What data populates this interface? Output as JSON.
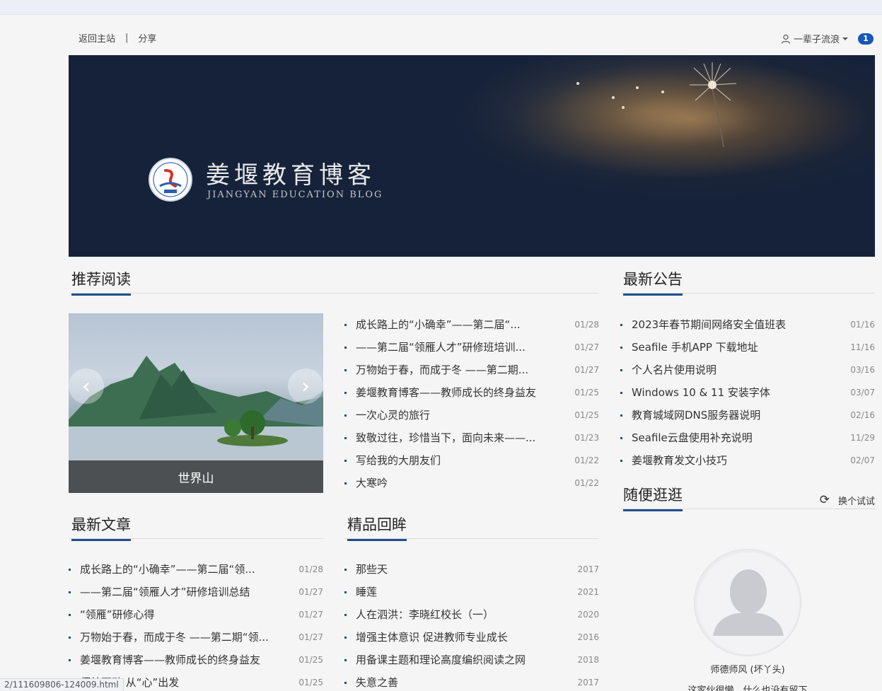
{
  "topbar": {
    "home_link": "返回主站",
    "divider": "|",
    "share_link": "分享",
    "username": "一辈子流浪",
    "notifications": "1"
  },
  "banner": {
    "title": "姜堰教育博客",
    "subtitle": "JIANGYAN EDUCATION BLOG"
  },
  "recommended": {
    "heading": "推荐阅读",
    "slide_caption": "世界山",
    "items": [
      {
        "title": "成长路上的“小确幸”——第二届“...",
        "date": "01/28"
      },
      {
        "title": "——第二届“领雁人才”研修班培训...",
        "date": "01/27"
      },
      {
        "title": "万物始于春，而成于冬 ——第二期...",
        "date": "01/27"
      },
      {
        "title": "姜堰教育博客——教师成长的终身益友",
        "date": "01/25"
      },
      {
        "title": "一次心灵的旅行",
        "date": "01/25"
      },
      {
        "title": "致敬过往，珍惜当下，面向未来——...",
        "date": "01/23"
      },
      {
        "title": "写给我的大朋友们",
        "date": "01/22"
      },
      {
        "title": "大寒吟",
        "date": "01/22"
      }
    ]
  },
  "announcements": {
    "heading": "最新公告",
    "items": [
      {
        "title": "2023年春节期间网络安全值班表",
        "date": "01/16"
      },
      {
        "title": "Seafile 手机APP 下载地址",
        "date": "11/16"
      },
      {
        "title": "个人名片使用说明",
        "date": "03/16"
      },
      {
        "title": "Windows 10 & 11 安装字体",
        "date": "03/07"
      },
      {
        "title": "教育城域网DNS服务器说明",
        "date": "02/16"
      },
      {
        "title": "Seafile云盘使用补充说明",
        "date": "11/29"
      },
      {
        "title": "姜堰教育发文小技巧",
        "date": "02/07"
      }
    ]
  },
  "random": {
    "heading": "随便逛逛",
    "refresh_label": "换个试试",
    "author": "师德师风 (坏丫头)",
    "author_desc": "这家伙很懒，什么也没有留下"
  },
  "latest": {
    "heading": "最新文章",
    "items": [
      {
        "title": "成长路上的“小确幸”——第二届“领...",
        "date": "01/28"
      },
      {
        "title": "——第二届“领雁人才”研修培训总结",
        "date": "01/27"
      },
      {
        "title": "“领雁”研修心得",
        "date": "01/27"
      },
      {
        "title": "万物始于春，而成于冬 ——第二期“领...",
        "date": "01/27"
      },
      {
        "title": "姜堰教育博客——教师成长的终身益友",
        "date": "01/25"
      },
      {
        "title": "师幼互动 从“心”出发",
        "date": "01/25"
      }
    ]
  },
  "classics": {
    "heading": "精品回眸",
    "items": [
      {
        "title": "那些天",
        "date": "2017"
      },
      {
        "title": "睡莲",
        "date": "2021"
      },
      {
        "title": "人在泗洪：李晓红校长（一）",
        "date": "2020"
      },
      {
        "title": "增强主体意识 促进教师专业成长",
        "date": "2016"
      },
      {
        "title": "用备课主题和理论高度编织阅读之网",
        "date": "2018"
      },
      {
        "title": "失意之善",
        "date": "2017"
      }
    ]
  },
  "status_url": "2/111609806-124009.html",
  "colors": {
    "accent": "#1f4f8e",
    "banner_bg": "#15223a",
    "badge": "#1a56b5"
  }
}
